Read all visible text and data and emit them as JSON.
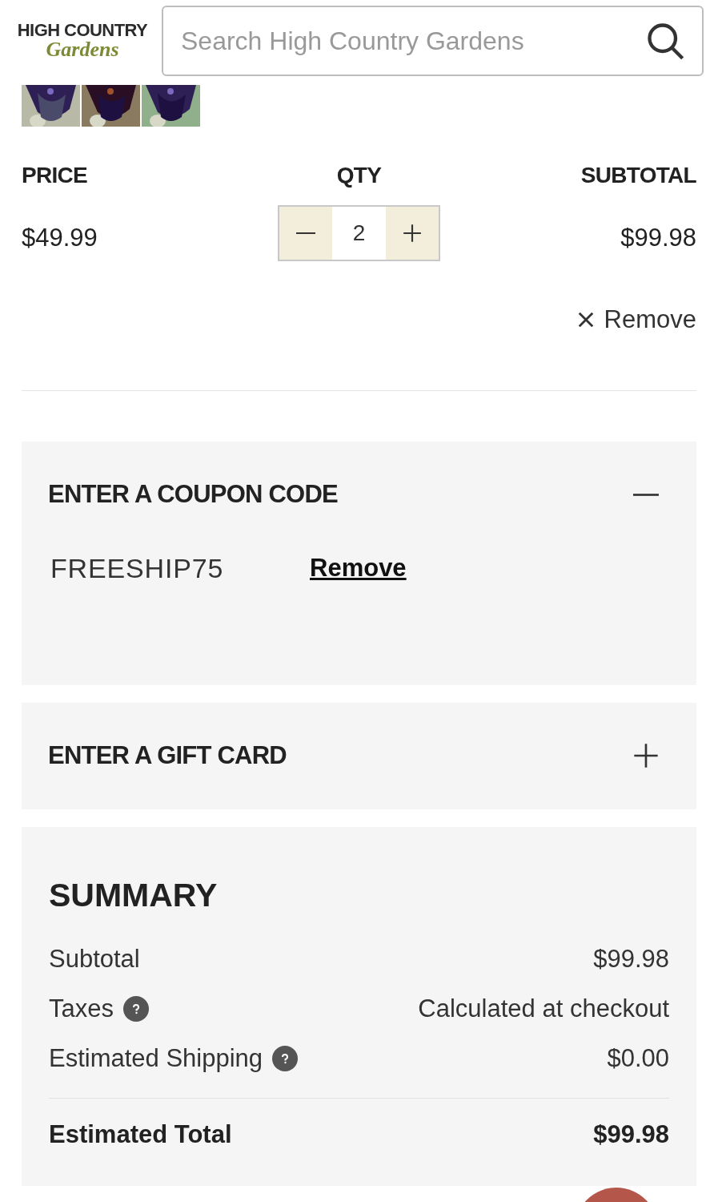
{
  "header": {
    "logo": {
      "line_1": "HIGH COUNTRY",
      "line_2": "Gardens"
    },
    "search": {
      "placeholder": "Search High Country Gardens"
    }
  },
  "cart_item": {
    "price_label": "PRICE",
    "price": "$49.99",
    "qty_label": "QTY",
    "qty": "2",
    "subtotal_label": "SUBTOTAL",
    "subtotal": "$99.98",
    "remove": "Remove"
  },
  "panels": [
    {
      "title": "ENTER A COUPON CODE",
      "expanded": true,
      "coupon": "FREESHIP75",
      "remove": "Remove"
    },
    {
      "title": "ENTER A GIFT CARD",
      "expanded": false
    }
  ],
  "summary": {
    "title": "SUMMARY",
    "rows": [
      {
        "label": "Subtotal",
        "value": "$99.98",
        "help": false
      },
      {
        "label": "Taxes",
        "value": "Calculated at checkout",
        "help": true
      },
      {
        "label": "Estimated Shipping",
        "value": "$0.00",
        "help": true
      }
    ],
    "total": {
      "label": "Estimated Total",
      "value": "$99.98"
    }
  }
}
